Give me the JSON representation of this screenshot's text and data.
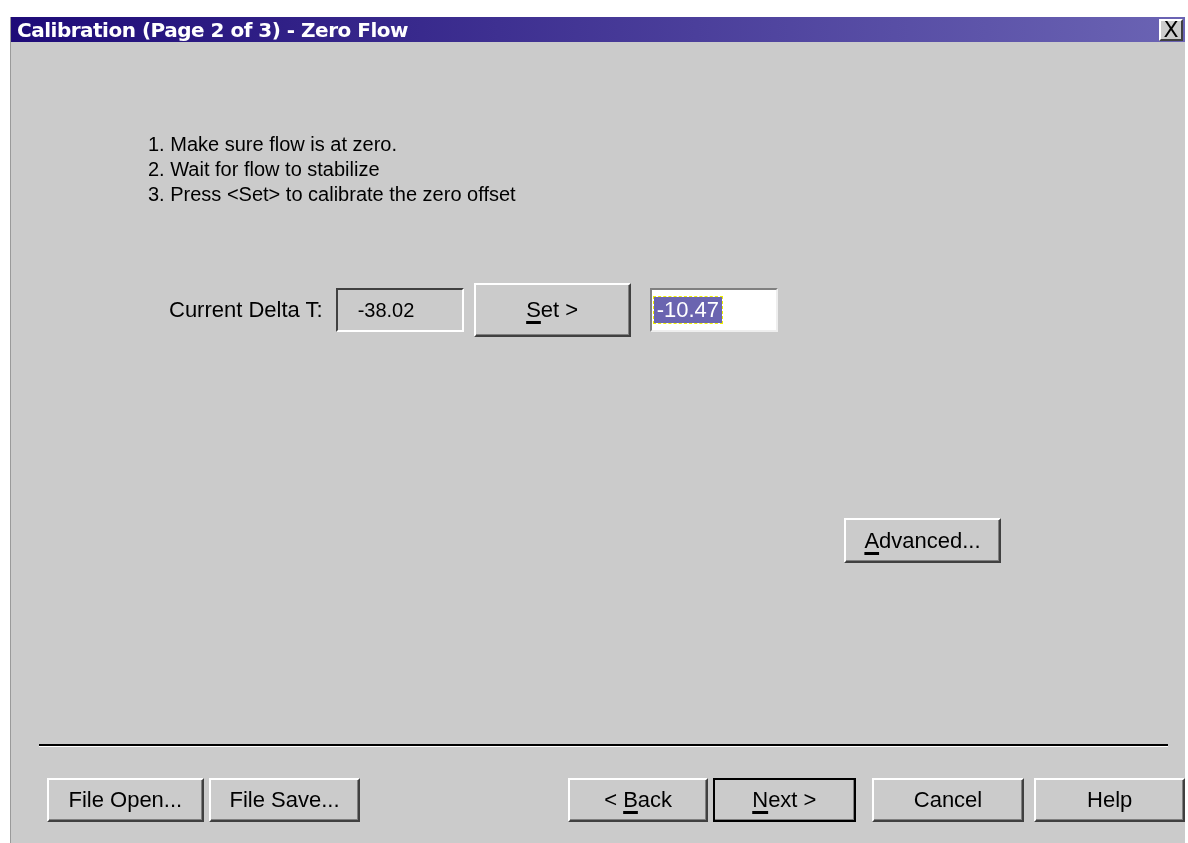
{
  "window": {
    "title": "Calibration (Page 2 of 3) - Zero Flow",
    "close": "X"
  },
  "instructions": [
    "1. Make sure flow is at zero.",
    "2. Wait for flow to stabilize",
    "3. Press <Set> to calibrate the zero offset"
  ],
  "delta": {
    "label": "Current Delta T:",
    "reading": "-38.02",
    "set_button": {
      "access_key": "S",
      "label_rest": "et >"
    },
    "offset": {
      "value": "-10.47",
      "text_selected": true
    }
  },
  "advanced_button": {
    "access_key": "A",
    "label_rest": "dvanced..."
  },
  "footer_buttons": [
    {
      "label": "File Open...",
      "default": false
    },
    {
      "label": "File Save...",
      "default": false
    },
    {
      "label": "< ",
      "access_key": "B",
      "label_rest": "ack",
      "default": false
    },
    {
      "access_key": "N",
      "label_rest": "ext >",
      "default": true
    },
    {
      "label": "Cancel",
      "default": false
    },
    {
      "label": "Help",
      "default": false
    }
  ]
}
